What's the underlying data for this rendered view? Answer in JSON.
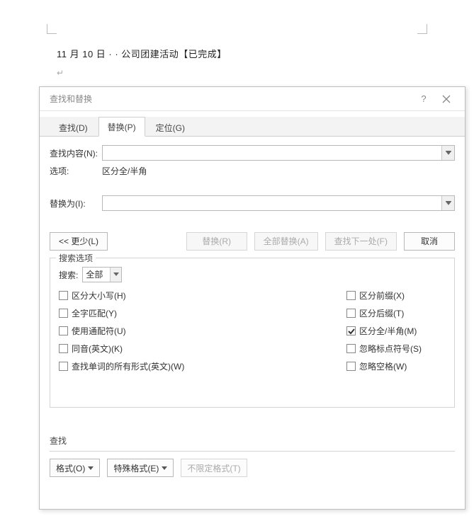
{
  "document": {
    "line": "11 月 10 日 · · 公司团建活动【已完成】",
    "return_mark": "↵"
  },
  "dialog": {
    "title": "查找和替换",
    "help_tooltip": "?",
    "tabs": {
      "find": "查找(D)",
      "replace": "替换(P)",
      "goto": "定位(G)"
    },
    "find_what_label": "查找内容(N):",
    "find_what_value": "",
    "options_label": "选项:",
    "options_value": "区分全/半角",
    "replace_with_label": "替换为(I):",
    "replace_with_value": "",
    "buttons": {
      "less": "<< 更少(L)",
      "replace": "替换(R)",
      "replace_all": "全部替换(A)",
      "find_next": "查找下一处(F)",
      "cancel": "取消"
    },
    "search_options": {
      "legend": "搜索选项",
      "direction_label": "搜索:",
      "direction_value": "全部",
      "left": {
        "match_case": "区分大小写(H)",
        "whole_word": "全字匹配(Y)",
        "wildcards": "使用通配符(U)",
        "sounds_like": "同音(英文)(K)",
        "all_forms": "查找单词的所有形式(英文)(W)"
      },
      "right": {
        "match_prefix": "区分前缀(X)",
        "match_suffix": "区分后缀(T)",
        "match_width": "区分全/半角(M)",
        "ignore_punct": "忽略标点符号(S)",
        "ignore_space": "忽略空格(W)"
      }
    },
    "find_section": {
      "heading": "查找",
      "format_btn": "格式(O)",
      "special_btn": "特殊格式(E)",
      "no_format_btn": "不限定格式(T)"
    }
  }
}
